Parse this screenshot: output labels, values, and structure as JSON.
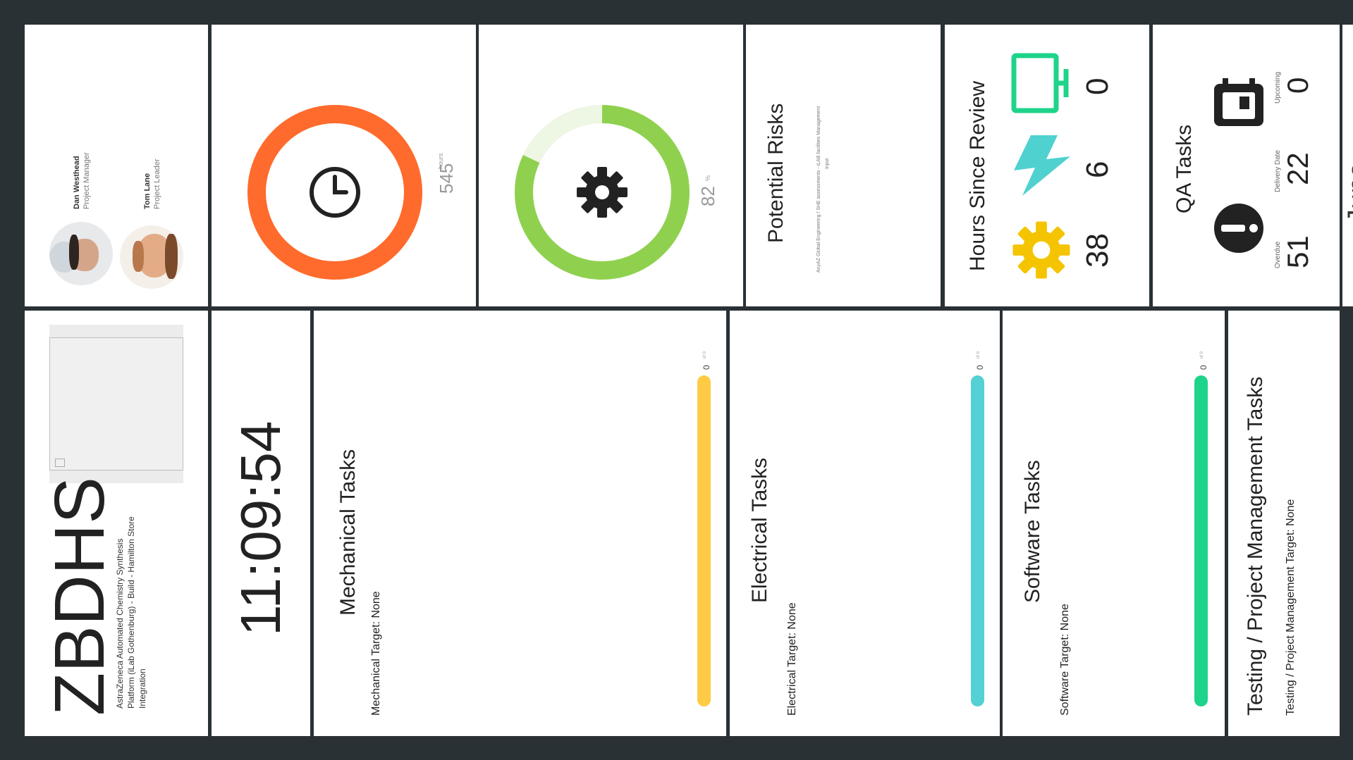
{
  "project": {
    "code": "ZBDHS",
    "description_lines": [
      "AstraZeneca Automated Chemistry Synthesis",
      "Platform (iLab Gothenburg) - Build - Hamilton Store",
      "Integration"
    ]
  },
  "team": [
    {
      "name": "Dan Westhead",
      "role": "Project Manager"
    },
    {
      "name": "Tom Lane",
      "role": "Project Leader"
    }
  ],
  "clock": {
    "time": "11:09:54"
  },
  "hours_ring": {
    "value": "545",
    "unit": "hours",
    "color": "#ff6b2c",
    "percent": 100
  },
  "progress_ring": {
    "value": "82",
    "unit": "%",
    "color": "#8fd14f",
    "percent": 82
  },
  "potential_risks": {
    "title": "Potential Risks",
    "note_line1": "AnyAZ Global Engineering / SHE assessments - iLAB facilities Management",
    "note_line2": "input"
  },
  "hours_since_review": {
    "title": "Hours Since Review",
    "items": [
      {
        "icon": "gear-icon",
        "value": "38",
        "color": "#f5c400"
      },
      {
        "icon": "lightning-icon",
        "value": "6",
        "color": "#4fd1d0"
      },
      {
        "icon": "monitor-icon",
        "value": "0",
        "color": "#1ed38a"
      }
    ]
  },
  "qa_tasks": {
    "title": "QA Tasks",
    "overdue": {
      "label": "Overdue",
      "value": "51"
    },
    "delivery": {
      "label": "Delivery Date",
      "value": "22"
    },
    "upcoming": {
      "label": "Upcoming",
      "value": "0"
    }
  },
  "side_label": "June",
  "tasks": [
    {
      "title": "Mechanical Tasks",
      "target": "Mechanical Target: None",
      "count": "0",
      "unit": "of 0",
      "color": "#ffca44"
    },
    {
      "title": "Electrical Tasks",
      "target": "Electrical Target: None",
      "count": "0",
      "unit": "of 0",
      "color": "#55d0d4"
    },
    {
      "title": "Software Tasks",
      "target": "Software Target: None",
      "count": "0",
      "unit": "of 0",
      "color": "#1ed38a"
    },
    {
      "title": "Testing / Project Management Tasks",
      "target": "Testing / Project Management Target: None"
    }
  ]
}
